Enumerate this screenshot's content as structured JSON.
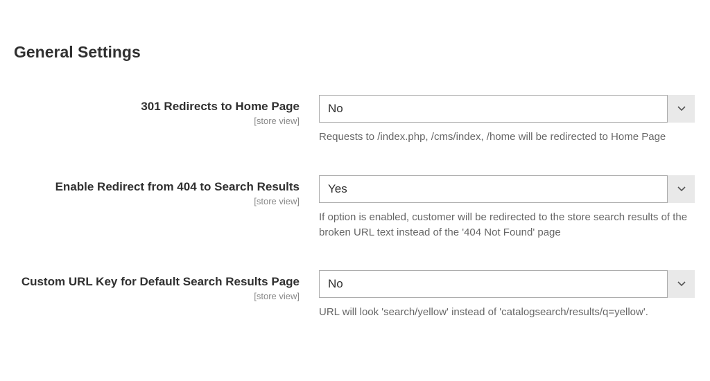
{
  "section": {
    "title": "General Settings"
  },
  "fields": {
    "redirect_home": {
      "label": "301 Redirects to Home Page",
      "scope": "[store view]",
      "value": "No",
      "note": "Requests to /index.php, /cms/index, /home will be redirected to Home Page"
    },
    "redirect_404": {
      "label": "Enable Redirect from 404 to Search Results",
      "scope": "[store view]",
      "value": "Yes",
      "note": "If option is enabled, customer will be redirected to the store search results of the broken URL text instead of the '404 Not Found' page"
    },
    "custom_url_key": {
      "label": "Custom URL Key for Default Search Results Page",
      "scope": "[store view]",
      "value": "No",
      "note": "URL will look 'search/yellow' instead of 'catalogsearch/results/q=yellow'."
    }
  }
}
